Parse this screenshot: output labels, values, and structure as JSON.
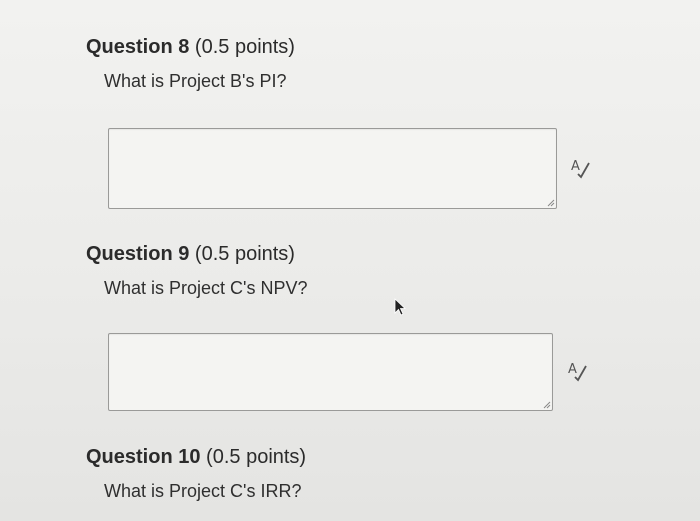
{
  "questions": [
    {
      "label": "Question",
      "number": "8",
      "points": "(0.5 points)",
      "prompt": "What is Project B's PI?",
      "answer_value": "",
      "spellcheck_icon": "spellcheck-icon"
    },
    {
      "label": "Question",
      "number": "9",
      "points": "(0.5 points)",
      "prompt": "What is Project C's NPV?",
      "answer_value": "",
      "spellcheck_icon": "spellcheck-icon"
    },
    {
      "label": "Question",
      "number": "10",
      "points": "(0.5 points)",
      "prompt": "What is Project C's IRR?"
    }
  ],
  "colors": {
    "text": "#2b2b2b",
    "box_border": "#9a9a98",
    "background": "#efefed"
  }
}
